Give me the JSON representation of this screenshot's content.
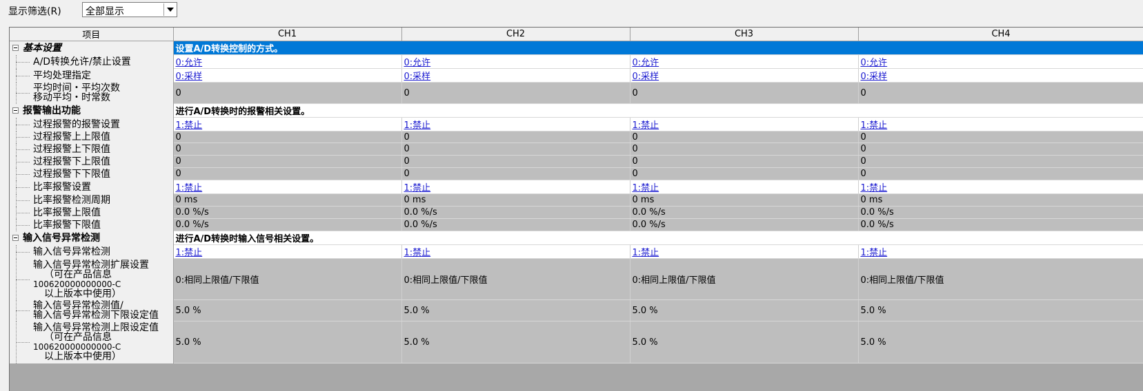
{
  "filter": {
    "label": "显示筛选(R)",
    "selected": "全部显示"
  },
  "columns": [
    "项目",
    "CH1",
    "CH2",
    "CH3",
    "CH4"
  ],
  "sections": [
    {
      "title": "基本设置",
      "description": "设置A/D转换控制的方式。",
      "rows": [
        {
          "name": "A/D转换允许/禁止设置",
          "value": "0:允许",
          "kind": "white"
        },
        {
          "name": "平均处理指定",
          "value": "0:采样",
          "kind": "white"
        },
        {
          "name": "平均时间・平均次数\n移动平均・时常数",
          "value": "0",
          "kind": "gray"
        }
      ]
    },
    {
      "title": "报警输出功能",
      "description": "进行A/D转换时的报警相关设置。",
      "rows": [
        {
          "name": "过程报警的报警设置",
          "value": "1:禁止",
          "kind": "white"
        },
        {
          "name": "过程报警上上限值",
          "value": "0",
          "kind": "gray"
        },
        {
          "name": "过程报警上下限值",
          "value": "0",
          "kind": "gray"
        },
        {
          "name": "过程报警下上限值",
          "value": "0",
          "kind": "gray"
        },
        {
          "name": "过程报警下下限值",
          "value": "0",
          "kind": "gray"
        },
        {
          "name": "比率报警设置",
          "value": "1:禁止",
          "kind": "white"
        },
        {
          "name": "比率报警检测周期",
          "value": "0 ms",
          "kind": "gray"
        },
        {
          "name": "比率报警上限值",
          "value": "0.0 %/s",
          "kind": "gray"
        },
        {
          "name": "比率报警下限值",
          "value": "0.0 %/s",
          "kind": "gray"
        }
      ]
    },
    {
      "title": "输入信号异常检测",
      "description": "进行A/D转换时输入信号相关设置。",
      "rows": [
        {
          "name": "输入信号异常检测",
          "value": "1:禁止",
          "kind": "white"
        },
        {
          "name": "输入信号异常检测扩展设置\n（可在产品信息\n100620000000000-C\n以上版本中使用）",
          "value": "0:相同上限值/下限值",
          "kind": "gray"
        },
        {
          "name": "输入信号异常检测值/\n输入信号异常检测下限设定值",
          "value": "5.0 %",
          "kind": "gray"
        },
        {
          "name": "输入信号异常检测上限设定值\n（可在产品信息\n100620000000000-C\n以上版本中使用）",
          "value": "5.0 %",
          "kind": "gray"
        }
      ]
    }
  ]
}
